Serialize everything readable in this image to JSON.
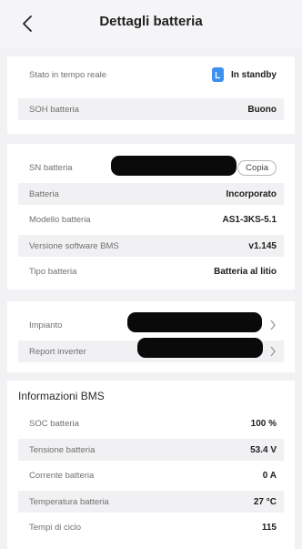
{
  "header": {
    "title": "Dettagli batteria"
  },
  "status": {
    "realtime_label": "Stato in tempo reale",
    "realtime_value": "In standby",
    "soh_label": "SOH batteria",
    "soh_value": "Buono"
  },
  "info": {
    "sn_label": "SN batteria",
    "copy_label": "Copia",
    "battery_label": "Batteria",
    "battery_value": "Incorporato",
    "model_label": "Modello batteria",
    "model_value": "AS1-3KS-5.1",
    "bms_sw_label": "Versione software BMS",
    "bms_sw_value": "v1.145",
    "type_label": "Tipo batteria",
    "type_value": "Batteria al litio"
  },
  "links": {
    "plant_label": "Impianto",
    "inverter_report_label": "Report inverter"
  },
  "bms": {
    "title": "Informazioni BMS",
    "soc_label": "SOC batteria",
    "soc_value": "100 %",
    "voltage_label": "Tensione batteria",
    "voltage_value": "53.4 V",
    "current_label": "Corrente batteria",
    "current_value": "0 A",
    "temp_label": "Temperatura batteria",
    "temp_value": "27 °C",
    "cycles_label": "Tempi di ciclo",
    "cycles_value": "115"
  },
  "colors": {
    "accent": "#3d8ff0",
    "background": "#f2f2f4",
    "redaction": "#0a0a0a"
  }
}
